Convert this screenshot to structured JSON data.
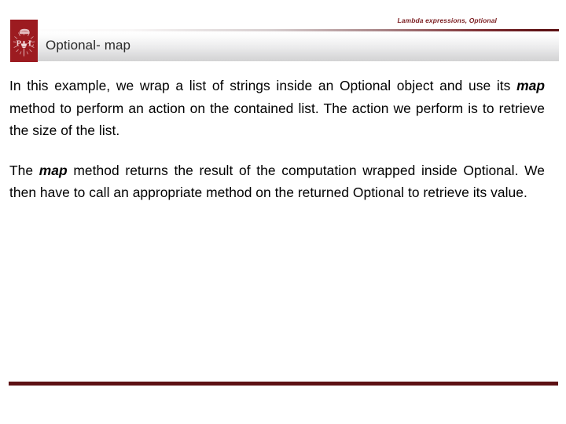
{
  "slide": {
    "running_head": "Lambda expressions, Optional",
    "title": "Optional- map",
    "logo": {
      "alt": "Lodz University of Technology crest",
      "letter_left": "P",
      "letter_right": "Ł"
    },
    "paragraphs": [
      {
        "id": "p1",
        "segments": [
          {
            "text": "In this example, we wrap a list of strings inside an Optional object and use its ",
            "style": "normal"
          },
          {
            "text": "map",
            "style": "bold-italic"
          },
          {
            "text": " method to perform an action on the contained list. The action we perform is to retrieve the size of the list.",
            "style": "normal"
          }
        ],
        "full_text": "In this example, we wrap a list of strings inside an Optional object and use its map method to perform an action on the contained list. The action we perform is to retrieve the size of the list."
      },
      {
        "id": "p2",
        "segments": [
          {
            "text": "The ",
            "style": "normal"
          },
          {
            "text": "map",
            "style": "bold-italic"
          },
          {
            "text": " method returns the result of the computation wrapped inside Optional. We then have to call an appropriate method on the returned Optional to retrieve its value.",
            "style": "normal"
          }
        ],
        "full_text": "The map method returns the result of the computation wrapped inside Optional. We then have to call an appropriate method on the returned Optional to retrieve its value."
      }
    ],
    "colors": {
      "brand_red": "#9c1b20",
      "rule_dark_red": "#5d1114",
      "running_head_red": "#7c1f22",
      "title_gray": "#2b2b2b",
      "body_black": "#000000",
      "band_gray": "#d3d3d4"
    }
  },
  "text_fragments": {
    "p1_a": "In this example, we wrap a list of strings inside an Optional object and use its ",
    "p1_kw": "map",
    "p1_b": " method to perform an action on the contained list. The action we perform is to retrieve the size of the list.",
    "p2_a": "The ",
    "p2_kw": "map",
    "p2_b": " method returns the result of the computation wrapped inside Optional. We then have to call an appropriate method on the returned Optional to retrieve its value."
  }
}
